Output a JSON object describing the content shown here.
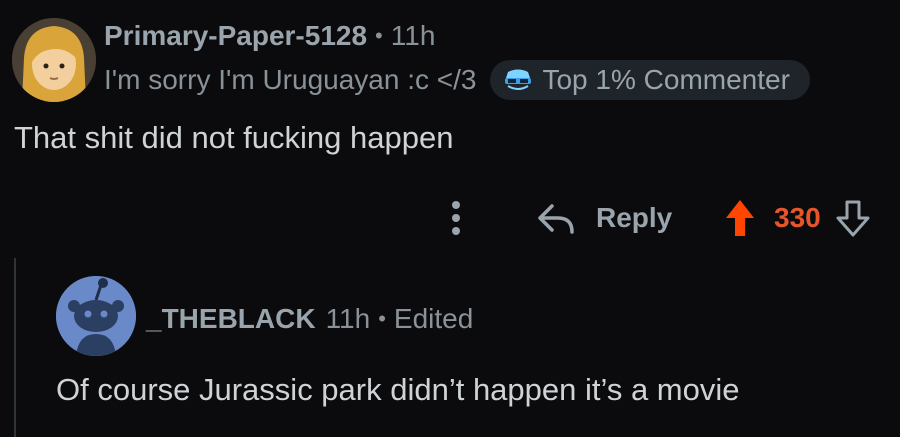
{
  "comment": {
    "username": "Primary-Paper-5128",
    "separator": "•",
    "time": "11h",
    "flair": "I'm sorry I'm Uruguayan :c </3",
    "badge": "Top 1% Commenter",
    "body": "That shit did not fucking happen",
    "reply_label": "Reply",
    "score": "330"
  },
  "reply": {
    "username": "_THEBLACK",
    "time": "11h",
    "separator": "•",
    "edited": "Edited",
    "body": "Of course Jurassic park didn’t happen it’s a movie"
  },
  "colors": {
    "background": "#0b0b0d",
    "upvote": "#ff4500",
    "score": "#e7562b",
    "badge_bg": "#1e2429"
  }
}
